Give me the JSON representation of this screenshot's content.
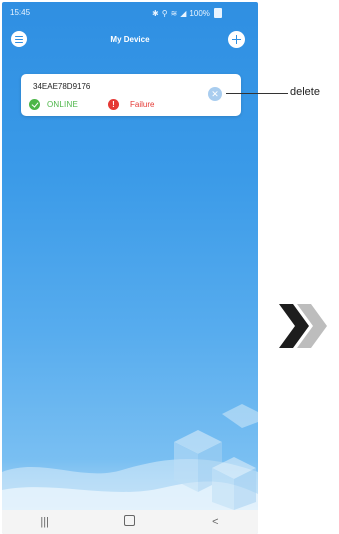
{
  "status_bar": {
    "time": "15:45",
    "battery": "100%"
  },
  "header": {
    "title": "My Device",
    "menu_icon": "menu-icon",
    "add_icon": "plus-icon"
  },
  "device_card": {
    "device_id": "34EAE78D9176",
    "online_label": "ONLINE",
    "failure_label": "Failure",
    "delete_icon": "close-icon"
  },
  "callout": {
    "label": "delete"
  },
  "nav": {
    "recents": "|||",
    "home": "",
    "back": "<"
  },
  "colors": {
    "accent": "#2f8fe2",
    "online": "#4cb648",
    "failure": "#e53935"
  }
}
